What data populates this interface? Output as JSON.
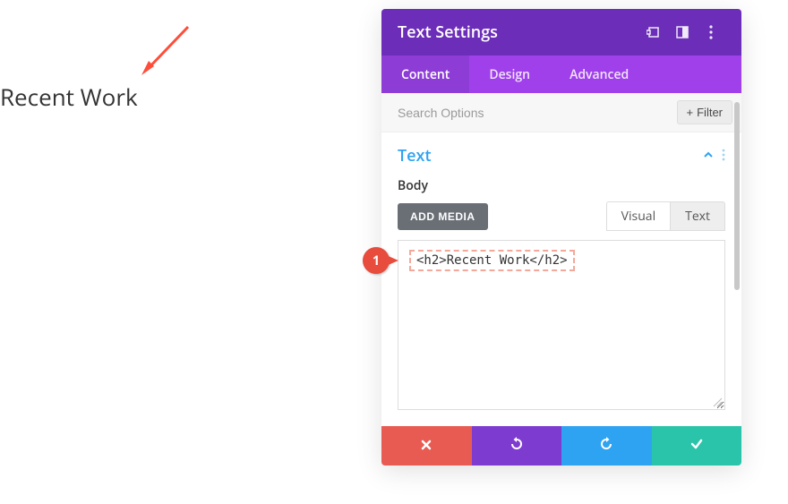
{
  "preview": {
    "heading": "Recent Work"
  },
  "callout": {
    "num": "1"
  },
  "panel": {
    "title": "Text Settings",
    "tabs": {
      "content": "Content",
      "design": "Design",
      "advanced": "Advanced"
    },
    "search_placeholder": "Search Options",
    "filter_label": "Filter"
  },
  "section": {
    "title": "Text",
    "body_label": "Body",
    "add_media": "ADD MEDIA",
    "mode_visual": "Visual",
    "mode_text": "Text",
    "editor_value": "<h2>Recent Work</h2>"
  }
}
